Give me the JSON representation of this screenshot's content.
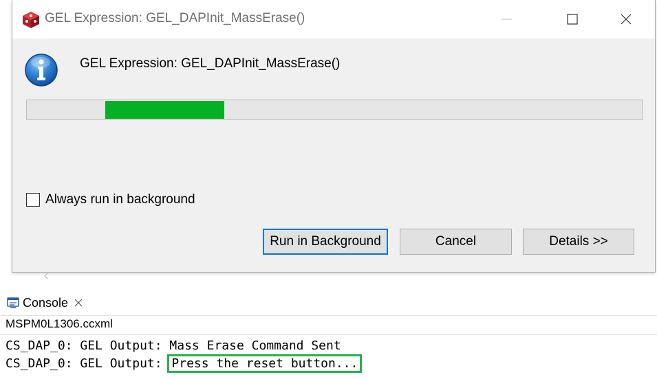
{
  "dialog": {
    "title": "GEL Expression: GEL_DAPInit_MassErase()",
    "message": "GEL Expression: GEL_DAPInit_MassErase()",
    "progress": {
      "segment_start": 0.128,
      "segment_end": 0.322,
      "fill_color": "#06b025"
    },
    "checkbox": {
      "label": "Always run in background",
      "checked": false
    },
    "buttons": {
      "run_background": "Run in Background",
      "cancel": "Cancel",
      "details": "Details >>"
    },
    "icons": {
      "app": "ccs-cube-icon",
      "info": "info-icon",
      "minimize": "minimize-icon",
      "maximize": "maximize-icon",
      "close": "close-icon"
    }
  },
  "console": {
    "tab_label": "Console",
    "file": "MSPM0L1306.ccxml",
    "lines": [
      {
        "prefix": "CS_DAP_0: GEL Output: ",
        "text": "Mass Erase Command Sent"
      },
      {
        "prefix": "CS_DAP_0: GEL Output: ",
        "text": "Press the reset button..."
      }
    ],
    "highlight_color": "#22b14c"
  },
  "colors": {
    "accent": "#0078d7",
    "brand_red": "#cc1f2d"
  }
}
